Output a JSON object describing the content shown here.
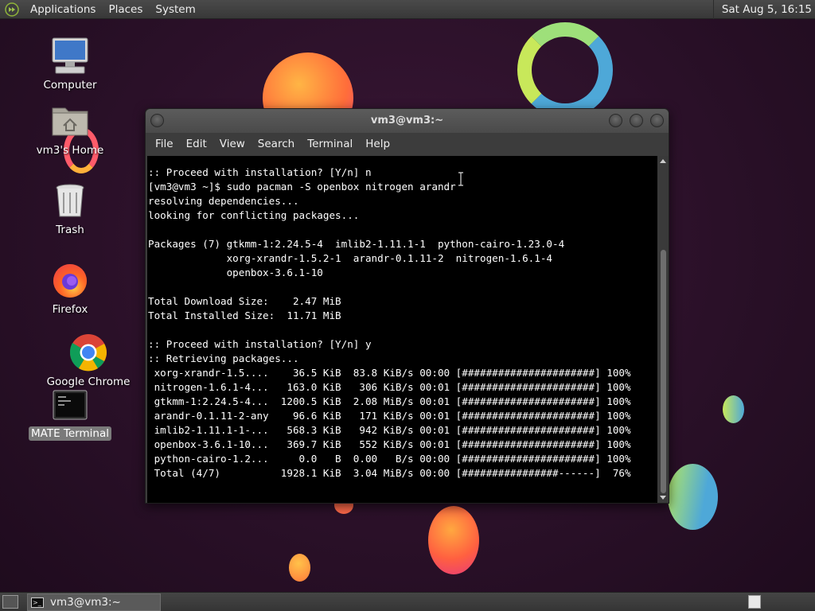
{
  "top_panel": {
    "menus": [
      "Applications",
      "Places",
      "System"
    ],
    "clock": "Sat Aug  5, 16:15"
  },
  "desktop_icons": [
    {
      "label": "Computer",
      "icon": "computer-icon"
    },
    {
      "label": "vm3's Home",
      "icon": "home-folder-icon"
    },
    {
      "label": "Trash",
      "icon": "trash-icon"
    },
    {
      "label": "Firefox",
      "icon": "firefox-icon"
    },
    {
      "label": "Google Chrome",
      "icon": "chrome-icon"
    },
    {
      "label": "MATE Terminal",
      "icon": "terminal-icon"
    }
  ],
  "terminal": {
    "title": "vm3@vm3:~",
    "menus": [
      "File",
      "Edit",
      "View",
      "Search",
      "Terminal",
      "Help"
    ],
    "lines": [
      ":: Proceed with installation? [Y/n] n",
      "[vm3@vm3 ~]$ sudo pacman -S openbox nitrogen arandr",
      "resolving dependencies...",
      "looking for conflicting packages...",
      "",
      "Packages (7) gtkmm-1:2.24.5-4  imlib2-1.11.1-1  python-cairo-1.23.0-4",
      "             xorg-xrandr-1.5.2-1  arandr-0.1.11-2  nitrogen-1.6.1-4",
      "             openbox-3.6.1-10",
      "",
      "Total Download Size:    2.47 MiB",
      "Total Installed Size:  11.71 MiB",
      "",
      ":: Proceed with installation? [Y/n] y",
      ":: Retrieving packages...",
      " xorg-xrandr-1.5....    36.5 KiB  83.8 KiB/s 00:00 [######################] 100%",
      " nitrogen-1.6.1-4...   163.0 KiB   306 KiB/s 00:01 [######################] 100%",
      " gtkmm-1:2.24.5-4...  1200.5 KiB  2.08 MiB/s 00:01 [######################] 100%",
      " arandr-0.1.11-2-any    96.6 KiB   171 KiB/s 00:01 [######################] 100%",
      " imlib2-1.11.1-1-...   568.3 KiB   942 KiB/s 00:01 [######################] 100%",
      " openbox-3.6.1-10...   369.7 KiB   552 KiB/s 00:01 [######################] 100%",
      " python-cairo-1.2...     0.0   B  0.00   B/s 00:00 [######################] 100%",
      " Total (4/7)          1928.1 KiB  3.04 MiB/s 00:00 [################------]  76%"
    ]
  },
  "bottom_panel": {
    "task_label": "vm3@vm3:~"
  }
}
